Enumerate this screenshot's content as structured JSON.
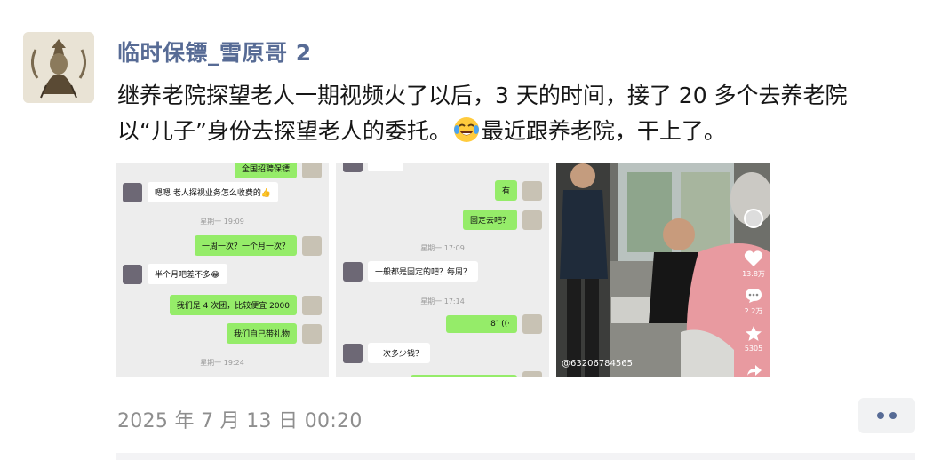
{
  "post": {
    "author": "临时保镖_雪原哥 2",
    "text_line1": "继养老院探望老人一期视频火了以后，3 天的时间，接了 20 多个去养老院",
    "text_line2_a": "以“儿子”身份去探望老人的委托。",
    "text_line2_b": "最近跟养老院，干上了。",
    "emoji": "face-with-tears-of-joy-icon",
    "timestamp": "2025 年 7 月 13 日 00:20"
  },
  "images": [
    {
      "kind": "chat-screenshot",
      "top_partial": "全国招聘保镖",
      "messages": [
        {
          "side": "in",
          "text": "嗯嗯 老人探视业务怎么收费的👍"
        },
        {
          "side": "time",
          "text": "星期一 19:09"
        },
        {
          "side": "out",
          "text": "一周一次？一个月一次？"
        },
        {
          "side": "in",
          "text": "半个月吧差不多😂"
        },
        {
          "side": "out",
          "text": "我们是 4 次团，比较便宜 2000"
        },
        {
          "side": "out",
          "text": "我们自己带礼物"
        },
        {
          "side": "time",
          "text": "星期一 19:24"
        }
      ]
    },
    {
      "kind": "chat-screenshot",
      "messages": [
        {
          "side": "out",
          "text": "有"
        },
        {
          "side": "out",
          "text": "固定去吧？"
        },
        {
          "side": "time",
          "text": "星期一 17:09"
        },
        {
          "side": "in",
          "text": "一般都是固定的吧？每周？"
        },
        {
          "side": "time",
          "text": "星期一 17:14"
        },
        {
          "side": "out",
          "text": "8″ ((·"
        },
        {
          "side": "in",
          "text": "一次多少钱？"
        }
      ]
    },
    {
      "kind": "video-frame",
      "watermark": "@63206784565",
      "stats": {
        "likes": "13.8万",
        "comments": "2.2万",
        "favorites": "5305"
      }
    }
  ],
  "colors": {
    "link_blue": "#576b95",
    "wechat_green": "#95ec69",
    "text_dark": "#161616",
    "timestamp_gray": "#8e8e8e"
  }
}
